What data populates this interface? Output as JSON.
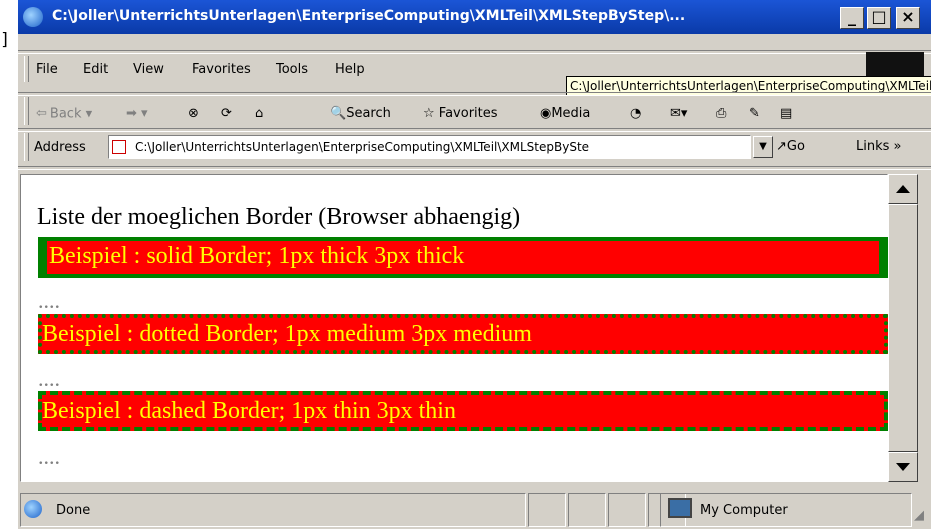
{
  "stray_text": "]",
  "window": {
    "title": "C:\\Joller\\UnterrichtsUnterlagen\\EnterpriseComputing\\XMLTeil\\XMLStepByStep\\...",
    "controls": {
      "minimize": "_",
      "maximize": "□",
      "close": "×"
    }
  },
  "menu": {
    "items": [
      "File",
      "Edit",
      "View",
      "Favorites",
      "Tools",
      "Help"
    ]
  },
  "tooltip": "C:\\Joller\\UnterrichtsUnterlagen\\EnterpriseComputing\\XMLTeil\\XMLStepByStep\\",
  "toolbar": {
    "back": "Back",
    "search": "Search",
    "favorites": "Favorites",
    "media": "Media"
  },
  "address": {
    "label": "Address",
    "value": "C:\\Joller\\UnterrichtsUnterlagen\\EnterpriseComputing\\XMLTeil\\XMLStepBySte",
    "go": "Go",
    "links": "Links"
  },
  "content": {
    "heading": "Liste der moeglichen Border (Browser abhaengig)",
    "example1": "Beispiel : solid Border; 1px thick 3px thick",
    "example2": "Beispiel : dotted Border; 1px medium 3px medium",
    "example3": "Beispiel : dashed Border; 1px thin 3px thin",
    "ellipsis": "...."
  },
  "status": {
    "text": "Done",
    "zone": "My Computer"
  },
  "colors": {
    "title_bar": "#0a3aa8",
    "box_background": "#ff0000",
    "box_text": "#ffff00",
    "box_border": "#008000"
  }
}
